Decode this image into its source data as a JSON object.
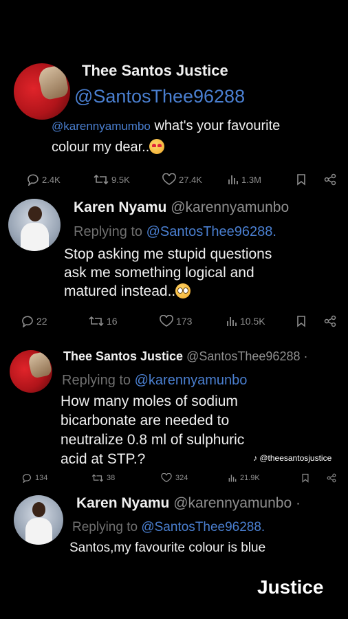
{
  "tweet1": {
    "name": "Thee Santos Justice",
    "handle": "@SantosThee96288",
    "mention": "@karennyamumbo",
    "text_line1": "what's your favourite",
    "text_line2": "colour my dear..",
    "emoji": "heart-eyes-emoji",
    "stats": {
      "replies": "2.4K",
      "retweets": "9.5K",
      "likes": "27.4K",
      "views": "1.3M"
    }
  },
  "tweet2": {
    "name": "Karen Nyamu",
    "handle": "@karennyamunbo",
    "replying_label": "Replying to",
    "replying_to": "@SantosThee96288.",
    "line1": "Stop asking me stupid questions",
    "line2": "ask me something logical and",
    "line3": "matured instead..",
    "emoji": "pleading-face-emoji",
    "stats": {
      "replies": "22",
      "retweets": "16",
      "likes": "173",
      "views": "10.5K"
    }
  },
  "tweet3": {
    "name": "Thee Santos Justice",
    "handle": "@SantosThee96288 ·",
    "replying_label": "Replying to",
    "replying_to": "@karennyamunbo",
    "line1": "How many moles of sodium",
    "line2": "bicarbonate are needed to",
    "line3": "neutralize 0.8 ml of sulphuric",
    "line4": "acid at STP.?",
    "stats": {
      "replies": "134",
      "retweets": "38",
      "likes": "324",
      "views": "21.9K"
    }
  },
  "tweet4": {
    "name": "Karen Nyamu",
    "handle": "@karennyamunbo ·",
    "replying_label": "Replying to",
    "replying_to": "@SantosThee96288.",
    "line1": "Santos,my favourite colour is blue"
  },
  "watermark": {
    "tiktok": "@theesantosjustice",
    "signature": "Justice"
  },
  "colors": {
    "background": "#000000",
    "link": "#4a7fd0",
    "muted": "#8e8e8e"
  }
}
